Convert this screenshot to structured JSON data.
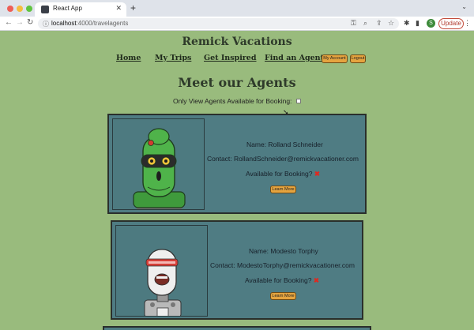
{
  "browser": {
    "tab_title": "React App",
    "tab_close": "✕",
    "new_tab": "+",
    "url_host": "localhost",
    "url_path": ":4000/travelagents",
    "profile_initial": "S",
    "update_label": "Update"
  },
  "site": {
    "title": "Remick Vacations",
    "nav": {
      "home": "Home",
      "my_trips": "My Trips",
      "get_inspired": "Get Inspired",
      "find_agent": "Find an Agent",
      "my_account": "My Account",
      "logout": "Logout"
    }
  },
  "main": {
    "heading": "Meet our Agents",
    "filter_label": "Only View Agents Available for Booking:",
    "filter_checked": false
  },
  "agents": [
    {
      "name": "Name: Rolland Schneider",
      "contact": "Contact: RollandSchneider@remickvacationer.com",
      "available": "Available for Booking?",
      "available_mark": "✖",
      "button": "Learn More",
      "avatar": "green-robot"
    },
    {
      "name": "Name: Modesto Torphy",
      "contact": "Contact: ModestoTorphy@remickvacationer.com",
      "available": "Available for Booking?",
      "available_mark": "✖",
      "button": "Learn More",
      "avatar": "white-robot"
    }
  ],
  "colors": {
    "page_bg": "#99bb7d",
    "card_bg": "#4f7c83",
    "button_bg": "#e5a43f",
    "unavailable": "#e0281f"
  }
}
